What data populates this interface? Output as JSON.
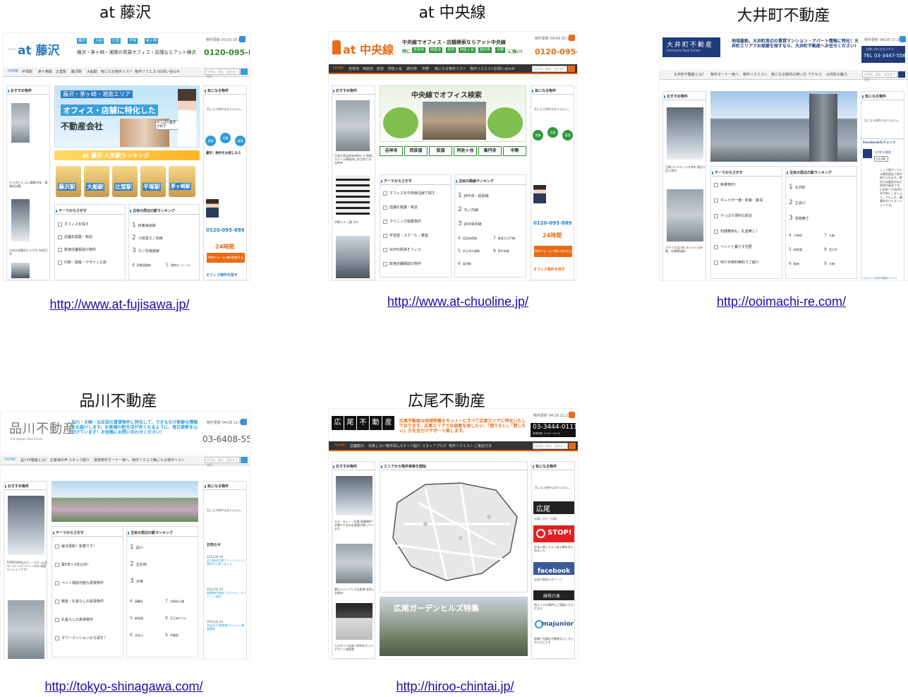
{
  "cards": [
    {
      "title": "at 藤沢",
      "url": "http://www.at-fujisawa.jp/",
      "site": {
        "logo": "at 藤沢",
        "tagline": "藤沢・茅ヶ崎・湘南の賃貸オフィス・店舗ならアット藤沢",
        "area_tags": [
          "藤沢",
          "大船",
          "辻堂",
          "平塚",
          "茅ヶ崎"
        ],
        "phone": "0120-095-889",
        "updated": "物件更新 05/19 18:02",
        "nav": [
          "HOME",
          "平塚駅",
          "茅ヶ崎駅",
          "辻堂駅",
          "藤沢駅",
          "大船駅",
          "気になる物件リスト",
          "物件リクエスト",
          "お問い合わせ"
        ],
        "search_placeholder": "住所名、駅名、会社名で検索",
        "left_heading": "おすすめ物件",
        "left_captions": [
          "ヤマダビル エレ場築10年、事務所店舗。",
          "日本生命藤沢ビル丁目 平成15年",
          "シソデル"
        ],
        "hero_line1": "藤沢・茅ヶ崎・湘南エリア",
        "hero_line2": "オフィス・店舗に特化した",
        "hero_line3": "不動産会社",
        "hero_bubble": "やっぱり藤沢が好き",
        "ranking_banner": "at 藤沢 人気駅ランキング",
        "stations": [
          "藤沢駅",
          "大船駅",
          "辻堂駅",
          "平塚駅",
          "茅ヶ崎駅"
        ],
        "theme_heading": "テーマからさがす",
        "themes": [
          "オフィスを探す",
          "店舗を開業・新店",
          "飲食店舗相談の物件",
          "印刷・製版・デザイン工房"
        ],
        "rank_heading": "注目の周辺の駅ランキング",
        "ranks": [
          "JR東海道線",
          "小田急江ノ島線",
          "江ノ島電鉄線",
          "JR横須賀線",
          "湘南モノレール"
        ],
        "right_heading": "気になる物件",
        "right_note": "気になる物件はありません。",
        "right_icons": [
          "賃貸",
          "売買",
          "管理"
        ],
        "right_title": "藤沢：物件をお探しなら",
        "right_phone": "0120-095-889",
        "right_24h": "24時間",
        "right_btn": "Webフォーム 無料相談する",
        "right_bottom": "オフィス物件を探す"
      }
    },
    {
      "title": "at 中央線",
      "url": "http://www.at-chuoline.jp/",
      "site": {
        "logo": "at 中央線",
        "tagline": "中央線でオフィス・店舗検索ならアット中央線",
        "area_tags": [
          "吉祥寺",
          "西荻窪",
          "荻窪",
          "阿佐ヶ谷",
          "高円寺",
          "中野"
        ],
        "tag_suffix": "に強い!",
        "tag_prefix": "特に",
        "phone": "0120-095-889",
        "updated": "物件更新 04/09 20:18",
        "nav": [
          "HOME",
          "吉祥寺",
          "西荻窪",
          "荻窪",
          "阿佐ヶ谷",
          "高円寺",
          "中野",
          "気になる物件リスト",
          "物件リクエスト",
          "お問い合わせ"
        ],
        "search_placeholder": "住所名、駅名、会社名で検索",
        "left_heading": "おすすめ物件",
        "left_captions": [
          "日本生命吉祥寺本町ビル 駅前。スクール事務所に好立地です。吉祥寺",
          "中野ビル 三菱 2/3"
        ],
        "hero_title": "中央線でオフィス検索",
        "hero_stations": [
          "吉祥寺",
          "西荻窪",
          "荻窪",
          "阿佐ヶ谷",
          "高円寺",
          "中野"
        ],
        "theme_heading": "テーマからさがす",
        "themes": [
          "オフィスを中央線沿線で探す",
          "店舗を開業・新店",
          "クリニック開業物件",
          "学習塾・スクール・教室",
          "SOHO賃貸オフィス",
          "飲食店舗相談の物件"
        ],
        "rank_heading": "注目の路線ランキング",
        "ranks": [
          "JR中央・総武線",
          "丸ノ内線",
          "JR中央本線",
          "西武新宿線",
          "京王井の頭線",
          "東西線",
          "都営大江戸線",
          "JR中央線"
        ],
        "right_heading": "気になる物件",
        "right_note": "気になる物件はありません。",
        "right_icons": [
          "賃貸",
          "売買",
          "管理"
        ],
        "right_phone": "0120-095-889",
        "right_24h": "24時間",
        "right_btn": "Webフォームで問い合わせる",
        "right_bottom": "オフィス物件を探す"
      }
    },
    {
      "title": "大井町不動産",
      "url": "http://ooimachi-re.com/",
      "site": {
        "logo": "大井町不動産",
        "logo_sub": "Ooimachi Real Estate",
        "tagline": "地域最新。大井町周辺の賃貸マンション・アパート情報に特化！大井町エリアでお部屋を探すなら、大井町不動産へお任せください!",
        "updated": "物件更新 04/18 17:18",
        "phone": "TEL 03-3447-5568",
        "phone_label": "お問い合わせはコチラ",
        "nav": [
          "大井町不動産とは？",
          "物件オーナー様へ",
          "物件リクエスト",
          "気になる物件の使い方",
          "アクセス",
          "大井町の魅力"
        ],
        "search_placeholder": "住所名、駅名、会社名で検索",
        "left_heading": "おすすめ物件",
        "left_captions": [
          "日興パレステージ大井町 駅近く 広々室内",
          "プライス品川町 オシャレな外観、信頼感抜群！"
        ],
        "theme_heading": "テーマからさがす",
        "themes": [
          "新着物件！",
          "キレイが一番！新築・築浅",
          "やっぱり便利な駅近",
          "初期費用も、礼金無し！",
          "ペットと暮らす住居",
          "仲介手数料無料でご紹介"
        ],
        "rank_heading": "注目の周辺の駅ランキング",
        "ranks": [
          "大井町",
          "立会川",
          "青物横丁",
          "下神明",
          "新馬場",
          "鮫洲",
          "大森",
          "西大井",
          "大崎"
        ],
        "right_heading": "気になる物件",
        "right_note": "気になる物件はありません。",
        "fb_heading": "Facebookもチェック",
        "fb_name": "大井町不動産",
        "fb_like": "いいね!",
        "right_text": "ここで紹介している費用設定で家が借りられます。都内では駅徒歩ほど家賃が高めです。5,000〜7,000円を目安にしましょう。でもこれ、種類別のバリエーションです。",
        "right_footer": "けんさく大井町不動産について"
      }
    },
    {
      "title": "品川不動産",
      "url": "http://tokyo-shinagawa.com/",
      "site": {
        "logo": "品川不動産",
        "logo_sub": "Shinagawa Real Estate",
        "tagline": "品川・大崎・五反田の賃貸物件に特化して、できるだけ新鮮な情報をお届けします。お客様の新生活が良くなるように、毎日更新を心がけています！お気軽にお問い合わせください！",
        "updated": "物件更新 04/18 12:47",
        "phone": "03-6408-5565",
        "nav": [
          "HOME",
          "品川不動産とは？",
          "お客様の声",
          "スタッフ紹介",
          "賃貸物件オーナー様へ",
          "物件リクエスト",
          "気になる物件リスト"
        ],
        "search_placeholder": "住所名、駅名、会社名で検索",
        "left_heading": "おすすめ物件",
        "left_captions": [
          "TOPROOM品川(トップルーム品川) コインランドリー付の 高層マンションです！"
        ],
        "theme_heading": "テーマからさがす",
        "themes": [
          "毎日更新！新着です！",
          "築5年〜2年以内！",
          "ペット相談可能な賃貸物件",
          "敷金・礼金なしの賃貸物件",
          "礼金なしの賃貸物件",
          "タワーマンションから探す！"
        ],
        "rank_heading": "注目の周辺の駅ランキング",
        "ranks": [
          "品川",
          "五反田",
          "大崎",
          "高輪台",
          "新馬場",
          "北品川",
          "大崎広小路",
          "天王洲アイル",
          "不動前"
        ],
        "right_heading": "気になる物件",
        "right_note": "気になる物件はありません。",
        "news_heading": "お知らせ",
        "news": [
          {
            "date": "2013.04.19",
            "text": "品川駅前戸建てリノベーション物件が入荷しました"
          },
          {
            "date": "2013.04.19",
            "text": "新築物件情報「ロイヤル・オーナー」追加"
          },
          {
            "date": "2013.04.19",
            "text": "五反田 戸建賃貸マンション情報更新"
          }
        ]
      }
    },
    {
      "title": "広尾不動産",
      "url": "http://hiroo-chintai.jp/",
      "site": {
        "logo_tiles": [
          "広",
          "尾",
          "不",
          "動",
          "産"
        ],
        "tagline": "広尾不動産は地域密着をモットーにすべて広尾エリアに特化いたしております。広尾エリアでお部屋を探したい、「借りたい」「貸したい」方を全力でサポート致します。",
        "updated": "物件更新 04/18 21:21",
        "phone": "03-3444-0111",
        "phone_sub": "営業時間 10:00〜19:00",
        "nav": [
          "HOME",
          "店舗案内",
          "失敗しない物件探し",
          "スタッフ紹介",
          "スタッフブログ",
          "物件リクエスト",
          "ご来店方法"
        ],
        "search_placeholder": "住所名、駅名、会社名で検索",
        "left_heading": "おすすめ物件",
        "left_captions": [
          "エル・セレーノ広尾 新築物件！お隣で人気のお部屋が揃っています",
          "朝日シティパリオ広尾南 女性にお勧め！",
          "カスタリア広尾 2006年グッドデザイン賞受賞"
        ],
        "map_heading": "エリアから物件検索を開始",
        "garden_label": "広尾ガーデンヒルズ特集",
        "right_heading": "気になる物件",
        "right_note": "気になる物件はありません。",
        "right_logo": "広尾",
        "right_logo_caption": "広尾に住む「広尾」",
        "stop_text": "STOP!",
        "stop_caption": "住まい探しでよくある事をまとめました",
        "fb_text": "facebook",
        "fb_caption": "広尾不動産公式ページ",
        "dark_label": "麻布六本",
        "dark_caption": "他エリアの物件もご相談いただけます",
        "majunior": "majunior",
        "majunior_caption": "賃貸と売買の不動産ならこちらからもどうぞ"
      }
    }
  ],
  "colors": {
    "link": "#1a0dab",
    "fujisawa_blue": "#2d9bd6",
    "chuo_orange": "#e86b15",
    "phone_green": "#2a8a2a",
    "ooimachi_navy": "#1f3b7a",
    "facebook_blue": "#3b5998"
  }
}
